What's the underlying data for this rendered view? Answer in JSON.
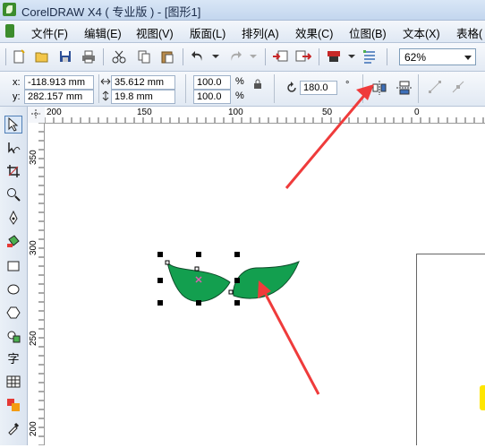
{
  "window": {
    "title": "CorelDRAW X4 ( 专业版 ) - [图形1]"
  },
  "menu": {
    "items": [
      "文件(F)",
      "编辑(E)",
      "视图(V)",
      "版面(L)",
      "排列(A)",
      "效果(C)",
      "位图(B)",
      "文本(X)",
      "表格("
    ]
  },
  "toolbar": {
    "zoom": "62%"
  },
  "property_bar": {
    "x_label": "x:",
    "x_value": "-118.913 mm",
    "y_label": "y:",
    "y_value": "282.157 mm",
    "width_value": "35.612 mm",
    "height_value": "19.8 mm",
    "scale_x": "100.0",
    "scale_y": "100.0",
    "percent": "%",
    "rotation": "180.0",
    "degree": "°"
  },
  "rulers": {
    "horizontal_labels": [
      "200",
      "150",
      "100",
      "50",
      "0"
    ],
    "vertical_labels": [
      "350",
      "300",
      "250",
      "200"
    ]
  },
  "colors": {
    "leaf_fill": "#139f4f",
    "arrow": "#ef3b3b",
    "title_gradient_top": "#d9e6f6"
  }
}
